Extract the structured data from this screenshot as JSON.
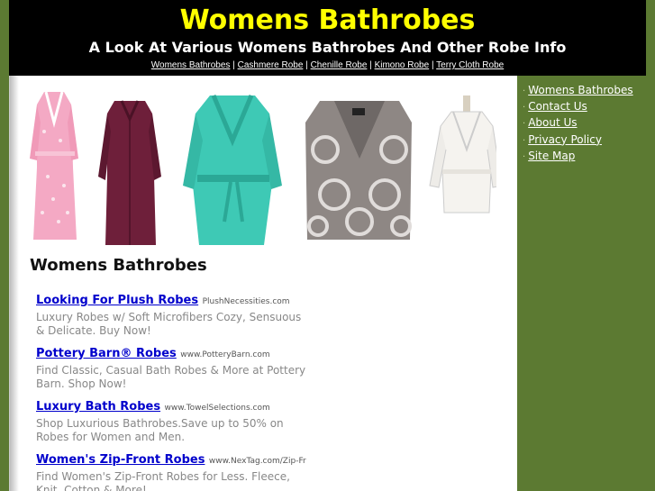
{
  "header": {
    "title": "Womens Bathrobes",
    "subtitle": "A Look At Various Womens Bathrobes And Other Robe Info",
    "nav": [
      "Womens Bathrobes",
      "Cashmere Robe",
      "Chenille Robe",
      "Kimono Robe",
      "Terry Cloth Robe"
    ],
    "nav_separator": "|"
  },
  "main": {
    "page_title": "Womens Bathrobes",
    "ads": [
      {
        "title": "Looking For Plush Robes",
        "url": "PlushNecessities.com",
        "desc": "Luxury Robes w/ Soft Microfibers Cozy, Sensuous & Delicate. Buy Now!"
      },
      {
        "title": "Pottery Barn® Robes",
        "url": "www.PotteryBarn.com",
        "desc": "Find Classic, Casual Bath Robes & More at Pottery Barn. Shop Now!"
      },
      {
        "title": "Luxury Bath Robes",
        "url": "www.TowelSelections.com",
        "desc": "Shop Luxurious Bathrobes.Save up to 50% on Robes for Women and Men."
      },
      {
        "title": "Women's Zip-Front Robes",
        "url": "www.NexTag.com/Zip-Front-...",
        "desc": "Find Women's Zip-Front Robes for Less. Fleece, Knit, Cotton & More!"
      }
    ]
  },
  "sidebar": {
    "bullet": "·",
    "items": [
      "Womens Bathrobes",
      "Contact Us",
      "About Us",
      "Privacy Policy",
      "Site Map"
    ]
  },
  "colors": {
    "header_bg": "#000000",
    "title": "#ffff00",
    "sidebar_bg": "#5c7a32",
    "ad_link": "#0000cc",
    "ad_desc": "#888888"
  },
  "images": [
    "pink-floral-robe",
    "burgundy-robe",
    "teal-plush-robe",
    "grey-pattern-robe",
    "white-waffle-robe"
  ]
}
